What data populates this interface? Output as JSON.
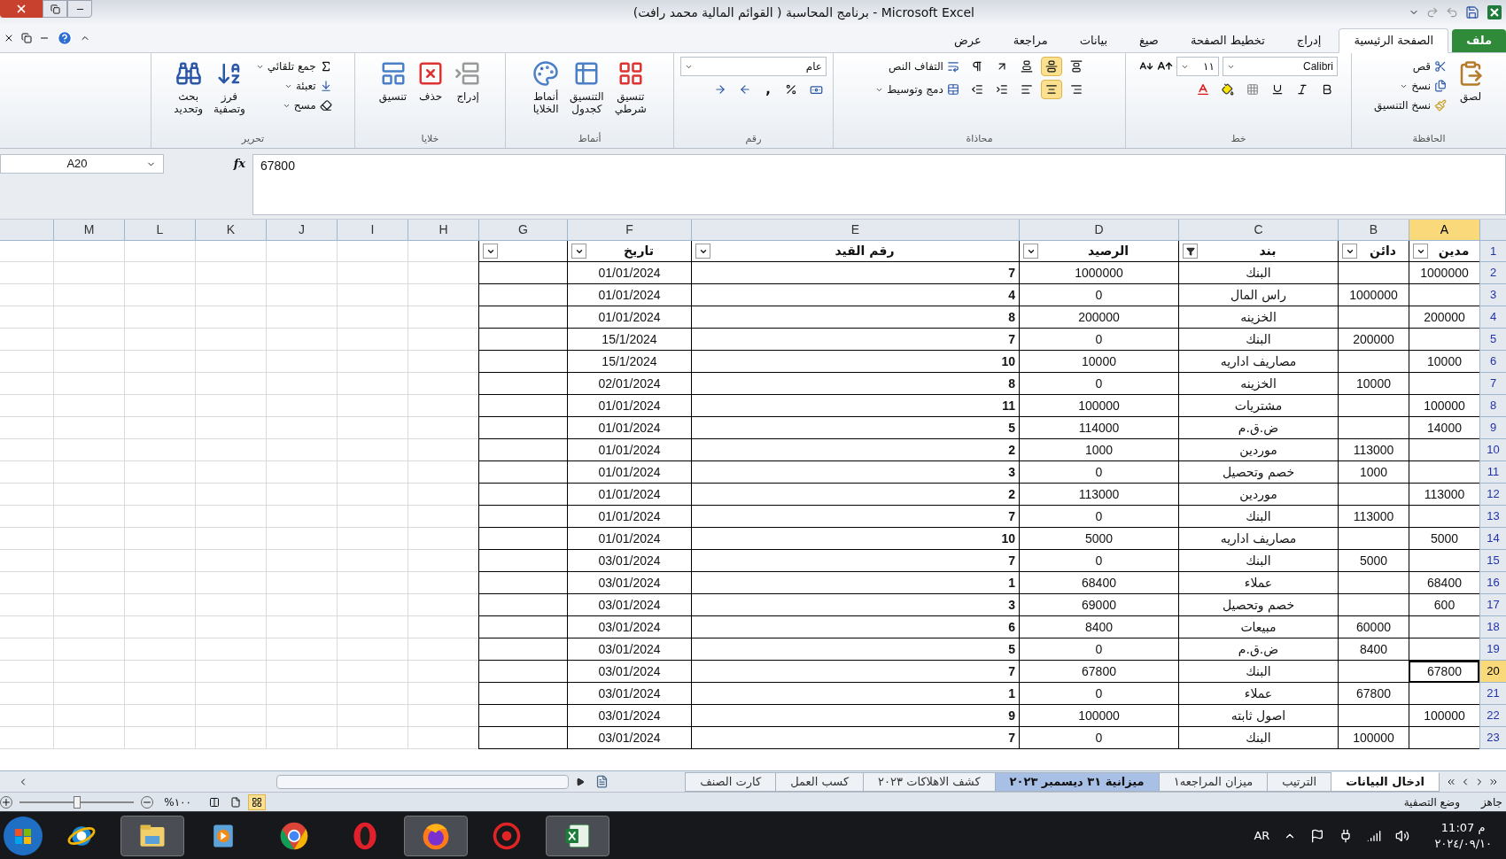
{
  "window": {
    "title": "برنامج المحاسبة ( القوائم المالية محمد رافت) - Microsoft Excel"
  },
  "tabs": [
    {
      "label": "ملف",
      "kind": "file",
      "selected": false
    },
    {
      "label": "الصفحة الرئيسية",
      "kind": "tab",
      "selected": true
    },
    {
      "label": "إدراج",
      "kind": "tab",
      "selected": false
    },
    {
      "label": "تخطيط الصفحة",
      "kind": "tab",
      "selected": false
    },
    {
      "label": "صيغ",
      "kind": "tab",
      "selected": false
    },
    {
      "label": "بيانات",
      "kind": "tab",
      "selected": false
    },
    {
      "label": "مراجعة",
      "kind": "tab",
      "selected": false
    },
    {
      "label": "عرض",
      "kind": "tab",
      "selected": false
    }
  ],
  "ribbon": {
    "clipboard": {
      "label": "الحافظة",
      "paste": "لصق",
      "cut": "قص",
      "copy": "نسخ",
      "format_painter": "نسخ التنسيق"
    },
    "font": {
      "label": "خط",
      "font_name": "Calibri",
      "font_size": "١١"
    },
    "alignment": {
      "label": "محاذاة",
      "vertical": [
        {
          "selected": false
        },
        {
          "selected": true
        },
        {
          "selected": false
        }
      ],
      "horizontal": [
        {
          "selected": false
        },
        {
          "selected": true
        },
        {
          "selected": false
        }
      ],
      "wrap_text": "التفاف النص",
      "merge": "دمج وتوسيط"
    },
    "number": {
      "label": "رقم",
      "format": "عام",
      "comma": ","
    },
    "styles": {
      "label": "أنماط",
      "conditional": "تنسيق\nشرطي",
      "as_table": "التنسيق\nكجدول",
      "cell_styles": "أنماط\nالخلايا"
    },
    "cells": {
      "label": "خلايا",
      "insert": "إدراج",
      "delete": "حذف",
      "format": "تنسيق"
    },
    "editing": {
      "label": "تحرير",
      "autosum": "جمع تلقائي",
      "fill": "تعبئة",
      "clear": "مسح",
      "sort": "فرز\nوتصفية",
      "find": "بحث\nوتحديد"
    }
  },
  "formula_bar": {
    "name_box": "A20",
    "fx": "fx",
    "value": "67800"
  },
  "columns": [
    {
      "letter": "A",
      "selected": true
    },
    {
      "letter": "B",
      "selected": false
    },
    {
      "letter": "C",
      "selected": false
    },
    {
      "letter": "D",
      "selected": false
    },
    {
      "letter": "E",
      "selected": false
    },
    {
      "letter": "F",
      "selected": false
    },
    {
      "letter": "G",
      "selected": false
    },
    {
      "letter": "H",
      "selected": false
    },
    {
      "letter": "I",
      "selected": false
    },
    {
      "letter": "J",
      "selected": false
    },
    {
      "letter": "K",
      "selected": false
    },
    {
      "letter": "L",
      "selected": false
    },
    {
      "letter": "M",
      "selected": false
    }
  ],
  "header_row": {
    "number": "1",
    "cells": [
      {
        "text": "مدين",
        "filtered": false
      },
      {
        "text": "دائن",
        "filtered": false
      },
      {
        "text": "بند",
        "filtered": true
      },
      {
        "text": "الرصيد",
        "filtered": false
      },
      {
        "text": "رقم القيد",
        "filtered": false
      },
      {
        "text": "تاريخ",
        "filtered": false
      },
      {
        "filtered": false
      }
    ]
  },
  "rows": [
    {
      "number": "2",
      "selected": false,
      "cells": [
        "1000000",
        "",
        "البنك",
        "1000000",
        "7",
        "01/01/2024"
      ]
    },
    {
      "number": "3",
      "selected": false,
      "cells": [
        "",
        "1000000",
        "راس المال",
        "0",
        "4",
        "01/01/2024"
      ]
    },
    {
      "number": "4",
      "selected": false,
      "cells": [
        "200000",
        "",
        "الخزينه",
        "200000",
        "8",
        "01/01/2024"
      ]
    },
    {
      "number": "5",
      "selected": false,
      "cells": [
        "",
        "200000",
        "البنك",
        "0",
        "7",
        "15/1/2024"
      ]
    },
    {
      "number": "6",
      "selected": false,
      "cells": [
        "10000",
        "",
        "مصاريف اداريه",
        "10000",
        "10",
        "15/1/2024"
      ]
    },
    {
      "number": "7",
      "selected": false,
      "cells": [
        "",
        "10000",
        "الخزينه",
        "0",
        "8",
        "02/01/2024"
      ]
    },
    {
      "number": "8",
      "selected": false,
      "cells": [
        "100000",
        "",
        "مشتريات",
        "100000",
        "11",
        "01/01/2024"
      ]
    },
    {
      "number": "9",
      "selected": false,
      "cells": [
        "14000",
        "",
        "ض.ق.م",
        "114000",
        "5",
        "01/01/2024"
      ]
    },
    {
      "number": "10",
      "selected": false,
      "cells": [
        "",
        "113000",
        "موردين",
        "1000",
        "2",
        "01/01/2024"
      ]
    },
    {
      "number": "11",
      "selected": false,
      "cells": [
        "",
        "1000",
        "خصم وتحصيل",
        "0",
        "3",
        "01/01/2024"
      ]
    },
    {
      "number": "12",
      "selected": false,
      "cells": [
        "113000",
        "",
        "موردين",
        "113000",
        "2",
        "01/01/2024"
      ]
    },
    {
      "number": "13",
      "selected": false,
      "cells": [
        "",
        "113000",
        "البنك",
        "0",
        "7",
        "01/01/2024"
      ]
    },
    {
      "number": "14",
      "selected": false,
      "cells": [
        "5000",
        "",
        "مصاريف اداريه",
        "5000",
        "10",
        "01/01/2024"
      ]
    },
    {
      "number": "15",
      "selected": false,
      "cells": [
        "",
        "5000",
        "البنك",
        "0",
        "7",
        "03/01/2024"
      ]
    },
    {
      "number": "16",
      "selected": false,
      "cells": [
        "68400",
        "",
        "عملاء",
        "68400",
        "1",
        "03/01/2024"
      ]
    },
    {
      "number": "17",
      "selected": false,
      "cells": [
        "600",
        "",
        "خصم وتحصيل",
        "69000",
        "3",
        "03/01/2024"
      ]
    },
    {
      "number": "18",
      "selected": false,
      "cells": [
        "",
        "60000",
        "مبيعات",
        "8400",
        "6",
        "03/01/2024"
      ]
    },
    {
      "number": "19",
      "selected": false,
      "cells": [
        "",
        "8400",
        "ض.ق.م",
        "0",
        "5",
        "03/01/2024"
      ]
    },
    {
      "number": "20",
      "selected": true,
      "cells": [
        "67800",
        "",
        "البنك",
        "67800",
        "7",
        "03/01/2024"
      ]
    },
    {
      "number": "21",
      "selected": false,
      "cells": [
        "",
        "67800",
        "عملاء",
        "0",
        "1",
        "03/01/2024"
      ]
    },
    {
      "number": "22",
      "selected": false,
      "cells": [
        "100000",
        "",
        "اصول ثابته",
        "100000",
        "9",
        "03/01/2024"
      ]
    },
    {
      "number": "23",
      "selected": false,
      "cells": [
        "",
        "100000",
        "البنك",
        "0",
        "7",
        "03/01/2024"
      ]
    }
  ],
  "sheet_tabs": [
    {
      "label": "ادخال البيانات",
      "selected": true,
      "grouped": false
    },
    {
      "label": "الترتيب",
      "selected": false,
      "grouped": false
    },
    {
      "label": "ميزان المراجعه١",
      "selected": false,
      "grouped": false
    },
    {
      "label": "ميزانية ٣١ ديسمبر ٢٠٢٣",
      "selected": false,
      "grouped": true
    },
    {
      "label": "كشف الاهلاكات ٢٠٢٣",
      "selected": false,
      "grouped": false
    },
    {
      "label": "كسب العمل",
      "selected": false,
      "grouped": false
    },
    {
      "label": "كارت الصنف",
      "selected": false,
      "grouped": false
    }
  ],
  "status_bar": {
    "items": [
      "جاهز",
      "وضع التصفية"
    ],
    "zoom": "%١٠٠",
    "zoom_slider": {
      "level": 0.5
    },
    "views": [
      {
        "selected": true
      },
      {
        "selected": false
      },
      {
        "selected": false
      }
    ]
  },
  "taskbar": {
    "apps": [
      {
        "selected": false
      },
      {
        "selected": true
      },
      {
        "selected": false
      },
      {
        "selected": false
      },
      {
        "selected": false
      },
      {
        "selected": true
      },
      {
        "selected": false
      },
      {
        "selected": true
      }
    ],
    "language": "AR",
    "time": "11:07 م",
    "date": "٢٠٢٤/٠٩/١٠"
  }
}
